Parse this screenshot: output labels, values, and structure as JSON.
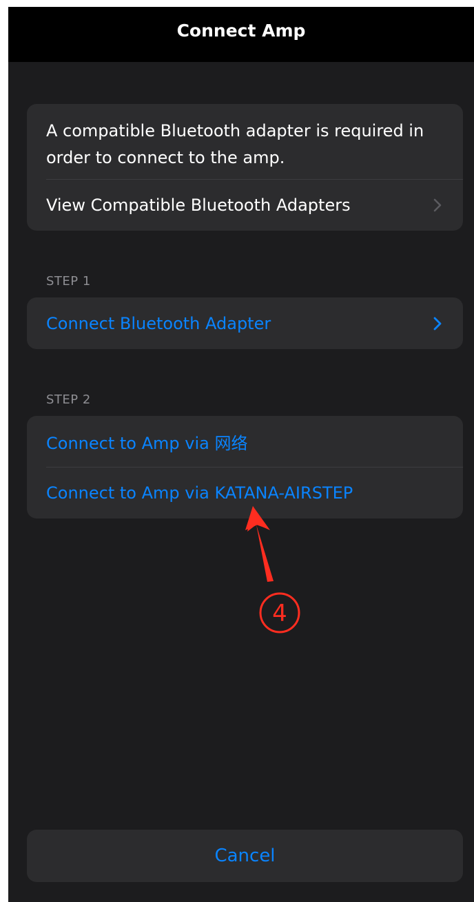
{
  "nav": {
    "title": "Connect Amp"
  },
  "info_card": {
    "message": "A compatible Bluetooth adapter is required in order to connect to the amp.",
    "link_label": "View Compatible Bluetooth Adapters"
  },
  "step1": {
    "header": "STEP 1",
    "item_label": "Connect Bluetooth Adapter"
  },
  "step2": {
    "header": "STEP 2",
    "items": [
      {
        "label": "Connect to Amp via 网络"
      },
      {
        "label": "Connect to Amp via KATANA-AIRSTEP"
      }
    ]
  },
  "annotation": {
    "marker": "④",
    "color": "#ff2d20"
  },
  "cancel": {
    "label": "Cancel"
  },
  "colors": {
    "background": "#1c1c1e",
    "card": "#2c2c2e",
    "accent": "#0a84ff",
    "secondary_text": "#8e8e93"
  },
  "icons": [
    "chevron-right-icon",
    "arrow-annotation-icon"
  ]
}
